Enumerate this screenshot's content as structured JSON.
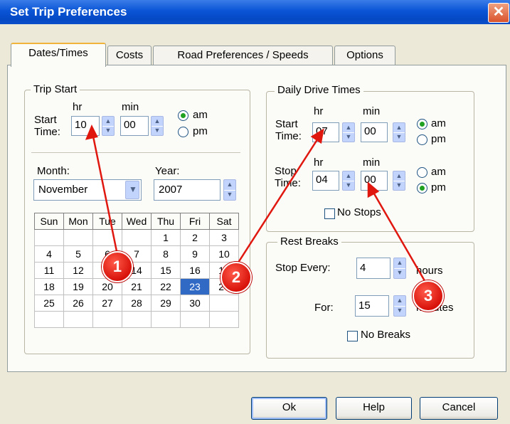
{
  "window": {
    "title": "Set Trip Preferences",
    "close_glyph": "✕"
  },
  "tabs": [
    {
      "label": "Dates/Times",
      "active": true
    },
    {
      "label": "Costs"
    },
    {
      "label": "Road Preferences / Speeds"
    },
    {
      "label": "Options"
    }
  ],
  "trip_start": {
    "legend": "Trip Start",
    "start_label_1": "Start",
    "start_label_2": "Time:",
    "hr_label": "hr",
    "min_label": "min",
    "hour": "10",
    "minute": "00",
    "am": "am",
    "pm": "pm",
    "selected": "am",
    "month_label": "Month:",
    "month": "November",
    "year_label": "Year:",
    "year": "2007"
  },
  "calendar": {
    "headers": [
      "Sun",
      "Mon",
      "Tue",
      "Wed",
      "Thu",
      "Fri",
      "Sat"
    ],
    "rows": [
      [
        "",
        "",
        "",
        "",
        "1",
        "2",
        "3"
      ],
      [
        "4",
        "5",
        "6",
        "7",
        "8",
        "9",
        "10"
      ],
      [
        "11",
        "12",
        "13",
        "14",
        "15",
        "16",
        "17"
      ],
      [
        "18",
        "19",
        "20",
        "21",
        "22",
        "23",
        "24"
      ],
      [
        "25",
        "26",
        "27",
        "28",
        "29",
        "30",
        ""
      ],
      [
        "",
        "",
        "",
        "",
        "",
        "",
        ""
      ]
    ],
    "selected_day": "23"
  },
  "daily_drive": {
    "legend": "Daily Drive Times",
    "start_label_1": "Start",
    "start_label_2": "Time:",
    "stop_label_1": "Stop",
    "stop_label_2": "Time:",
    "hr_label": "hr",
    "min_label": "min",
    "start_hour": "07",
    "start_minute": "00",
    "start_selected": "am",
    "stop_hour": "04",
    "stop_minute": "00",
    "stop_selected": "pm",
    "am": "am",
    "pm": "pm",
    "no_stops": "No Stops"
  },
  "rest_breaks": {
    "legend": "Rest Breaks",
    "stop_every_label": "Stop Every:",
    "stop_every_value": "4",
    "hours_label": "hours",
    "for_label": "For:",
    "for_value": "15",
    "minutes_label": "minutes",
    "no_breaks": "No Breaks"
  },
  "buttons": {
    "ok": "Ok",
    "help": "Help",
    "cancel": "Cancel"
  },
  "markers": [
    "1",
    "2",
    "3"
  ],
  "colors": {
    "marker": "#e0170f",
    "titlebar": "#0a55d6",
    "selection": "#316ac5"
  }
}
